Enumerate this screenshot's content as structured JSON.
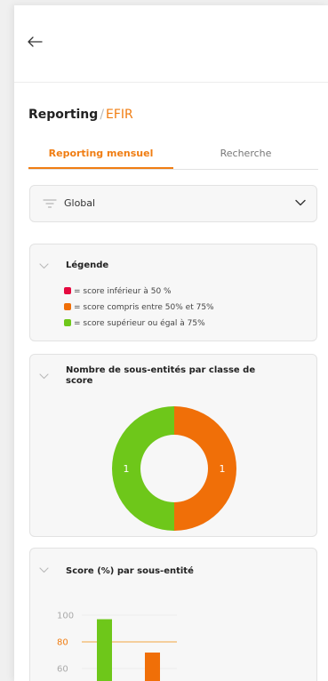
{
  "header": {
    "back_icon": "arrow-left-icon"
  },
  "page": {
    "title": "Reporting",
    "separator": "/",
    "subtitle": "EFIR"
  },
  "tabs": [
    {
      "label": "Reporting mensuel",
      "active": true
    },
    {
      "label": "Recherche",
      "active": false
    }
  ],
  "filter": {
    "icon": "filter-icon",
    "value": "Global",
    "chevron": "chevron-down-icon"
  },
  "legend_card": {
    "title": "Légende",
    "items": [
      {
        "color": "#e5093f",
        "text": "= score inférieur à 50 %"
      },
      {
        "color": "#f06f08",
        "text": "= score compris entre 50% et 75%"
      },
      {
        "color": "#6ec71a",
        "text": "= score supérieur ou égal à 75%"
      }
    ]
  },
  "donut_card": {
    "title_line1": "Nombre de sous-entités par classe de",
    "title_line2": "score"
  },
  "bar_card": {
    "title": "Score (%) par sous-entité"
  },
  "colors": {
    "accent": "#f07d12",
    "green": "#6ec71a",
    "orange": "#f06f08",
    "red": "#e5093f"
  },
  "chart_data": [
    {
      "type": "pie",
      "labels": [
        "score supérieur ou égal à 75%",
        "score compris entre 50% et 75%"
      ],
      "values": [
        1,
        1
      ],
      "colors": [
        "#6ec71a",
        "#f06f08"
      ],
      "title": "Nombre de sous-entités par classe de score"
    },
    {
      "type": "bar",
      "title": "Score (%) par sous-entité",
      "y_ticks": [
        100,
        80,
        60
      ],
      "reference_line": 80,
      "values": [
        97,
        72
      ],
      "colors": [
        "#6ec71a",
        "#f06f08"
      ],
      "ylim": [
        60,
        100
      ]
    }
  ]
}
